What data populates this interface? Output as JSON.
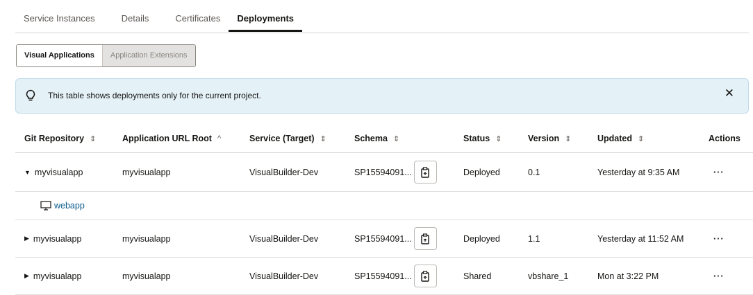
{
  "tabs": [
    {
      "label": "Service Instances"
    },
    {
      "label": "Details"
    },
    {
      "label": "Certificates"
    },
    {
      "label": "Deployments"
    }
  ],
  "toggle": {
    "visual": "Visual Applications",
    "extensions": "Application Extensions"
  },
  "banner": {
    "text": "This table shows deployments only for the current project.",
    "close": "✕"
  },
  "table": {
    "headers": {
      "git": "Git Repository",
      "url": "Application URL Root",
      "service": "Service (Target)",
      "schema": "Schema",
      "status": "Status",
      "version": "Version",
      "updated": "Updated",
      "actions": "Actions"
    },
    "rows": [
      {
        "git": "myvisualapp",
        "url": "myvisualapp",
        "service": "VisualBuilder-Dev",
        "schema": "SP15594091...",
        "status": "Deployed",
        "version": "0.1",
        "updated": "Yesterday at 9:35 AM",
        "actions": "···"
      },
      {
        "git": "myvisualapp",
        "url": "myvisualapp",
        "service": "VisualBuilder-Dev",
        "schema": "SP15594091...",
        "status": "Deployed",
        "version": "1.1",
        "updated": "Yesterday at 11:52 AM",
        "actions": "···"
      },
      {
        "git": "myvisualapp",
        "url": "myvisualapp",
        "service": "VisualBuilder-Dev",
        "schema": "SP15594091...",
        "status": "Shared",
        "version": "vbshare_1",
        "updated": "Mon at 3:22 PM",
        "actions": "···"
      }
    ],
    "subrow": {
      "label": "webapp"
    }
  },
  "colors": {
    "banner_bg": "#e4f1f7",
    "link": "#0b5a8c",
    "text": "#161513"
  }
}
